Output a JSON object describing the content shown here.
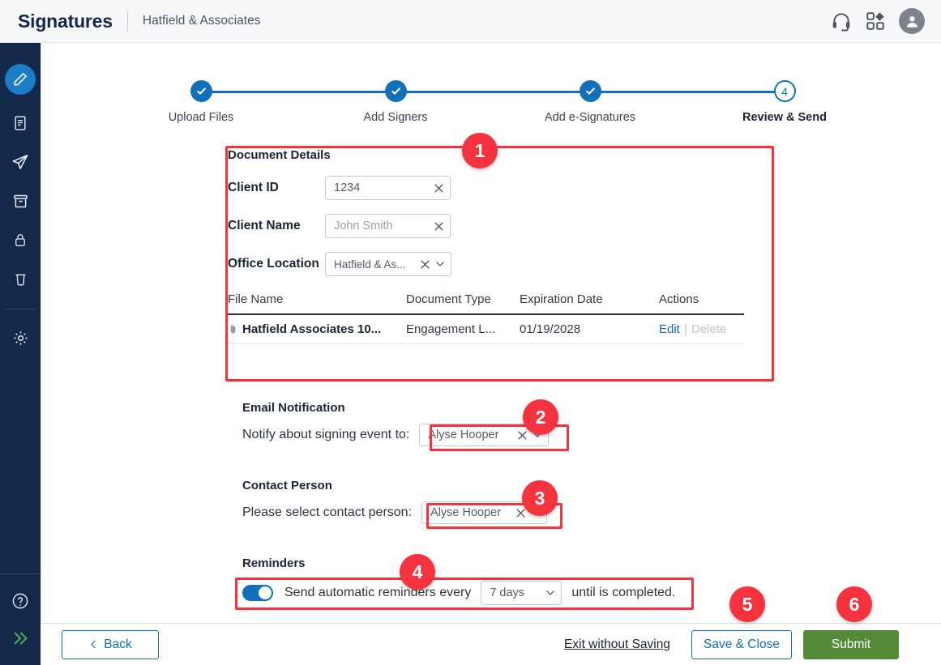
{
  "header": {
    "brand": "Signatures",
    "org": "Hatfield & Associates",
    "icons": [
      "headset-icon",
      "apps-grid-icon",
      "user-avatar-icon"
    ]
  },
  "sidebar": {
    "items": [
      {
        "icon": "pencil-icon",
        "active": true
      },
      {
        "icon": "document-icon",
        "active": false
      },
      {
        "icon": "send-icon",
        "active": false
      },
      {
        "icon": "archive-icon",
        "active": false
      },
      {
        "icon": "lock-icon",
        "active": false
      },
      {
        "icon": "trash-icon",
        "active": false
      },
      {
        "icon": "gear-icon",
        "active": false
      }
    ],
    "bottom": [
      {
        "icon": "help-circle-icon"
      },
      {
        "icon": "expand-chevrons-icon"
      }
    ]
  },
  "stepper": {
    "steps": [
      {
        "label": "Upload Files",
        "state": "complete",
        "mark": "✓"
      },
      {
        "label": "Add Signers",
        "state": "complete",
        "mark": "✓"
      },
      {
        "label": "Add e-Signatures",
        "state": "complete",
        "mark": "✓"
      },
      {
        "label": "Review & Send",
        "state": "current",
        "mark": "4"
      }
    ]
  },
  "document_details": {
    "title": "Document Details",
    "fields": [
      {
        "label": "Client ID",
        "value": "1234",
        "placeholder": false,
        "type": "text"
      },
      {
        "label": "Client Name",
        "value": "John Smith",
        "placeholder": true,
        "type": "text"
      },
      {
        "label": "Office Location",
        "value": "Hatfield & As...",
        "placeholder": false,
        "type": "select"
      }
    ],
    "table": {
      "columns": [
        "File Name",
        "Document Type",
        "Expiration Date",
        "Actions"
      ],
      "rows": [
        {
          "file_name": "Hatfield Associates 10...",
          "document_type": "Engagement L...",
          "expiration_date": "01/19/2028",
          "action_edit": "Edit",
          "action_delete": "Delete"
        }
      ]
    }
  },
  "email_notification": {
    "title": "Email Notification",
    "label": "Notify about signing event to:",
    "value": "Alyse Hooper"
  },
  "contact_person": {
    "title": "Contact Person",
    "label": "Please select contact person:",
    "value": "Alyse Hooper"
  },
  "reminders": {
    "title": "Reminders",
    "toggle_on": true,
    "text_before": "Send automatic reminders every",
    "interval_value": "7 days",
    "text_after": "until is completed."
  },
  "footer": {
    "back": "Back",
    "exit": "Exit without Saving",
    "save_close": "Save & Close",
    "submit": "Submit"
  },
  "annotations": {
    "badges": [
      "1",
      "2",
      "3",
      "4",
      "5",
      "6"
    ]
  },
  "colors": {
    "brand_navy": "#13294B",
    "accent_blue": "#1270B8",
    "submit_green": "#558B38",
    "annotation_red": "#F5333F"
  }
}
